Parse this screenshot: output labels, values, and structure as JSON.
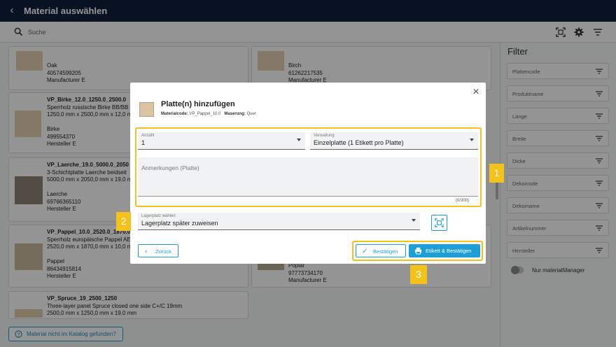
{
  "app": {
    "title": "Material auswählen"
  },
  "search": {
    "placeholder": "Suche"
  },
  "cards_left": [
    {
      "name": "",
      "lines": [
        "Oak",
        "40574599205",
        "Manufacturer E"
      ]
    },
    {
      "name": "VP_Birke_12.0_1250.0_2500.0",
      "lines": [
        "Sperrholz russische Birke BB/BB",
        "1250,0 mm x 2500,0 mm x 12,0 m",
        "",
        "Birke",
        "499554370",
        "Hersteller E"
      ]
    },
    {
      "name": "VP_Laerche_19.0_5000.0_2050",
      "lines": [
        "3-Schichtplatte Laerche beidseit",
        "5000,0 mm x 2050,0 mm x 19,0 m",
        "",
        "Laerche",
        "69766365110",
        "Hersteller E"
      ]
    },
    {
      "name": "VP_Pappel_10.0_2520.0_1870.0",
      "lines": [
        "Sperrholz europäische Pappel AE",
        "2520,0 mm x 1870,0 mm x 10,0 m",
        "",
        "Pappel",
        "86434915814",
        "Hersteller E"
      ]
    },
    {
      "name": "VP_Spruce_19_2500_1250",
      "lines": [
        "Three-layer panel Spruce closed one side C+/C 19mm",
        "2500,0 mm x 1250,0 mm x 19,0 mm"
      ]
    }
  ],
  "cards_right": [
    {
      "lines": [
        "Birch",
        "61262217535",
        "Manufacturer E"
      ]
    },
    {
      "lines": [
        "Poplar",
        "97773734170",
        "Manufacturer E"
      ]
    }
  ],
  "filter": {
    "title": "Filter",
    "items": [
      "Plattencode",
      "Produktname",
      "Länge",
      "Breite",
      "Dicke",
      "Dekorcode",
      "Dekorname",
      "Artikelnummer",
      "Hersteller"
    ],
    "toggle_label": "Nur materialManager"
  },
  "bottom_button": "Material nicht im Katalog gefunden?",
  "modal": {
    "title": "Platte(n) hinzufügen",
    "materialcode_label": "Materialcode:",
    "materialcode_value": "VP_Pappel_10.0",
    "maserung_label": "Maserung:",
    "maserung_value": "Quer",
    "anzahl_label": "Anzahl",
    "anzahl_value": "1",
    "verwaltung_label": "Verwaltung",
    "verwaltung_value": "Einzelplatte (1 Etikett pro Platte)",
    "anmerkungen_placeholder": "Anmerkungen (Platte)",
    "counter": "(0/300)",
    "lagerplatz_label": "Lagerplatz wählen",
    "lagerplatz_value": "Lagerplatz später zuweisen",
    "back_label": "Zurück",
    "confirm_label": "Bestätigen",
    "print_confirm_label": "Etikett & Bestätigen"
  },
  "badges": [
    "1",
    "2",
    "3"
  ],
  "colors": {
    "accent": "#1b9fd6",
    "highlight": "#f5c21b",
    "topbar": "#0f1f3d"
  }
}
